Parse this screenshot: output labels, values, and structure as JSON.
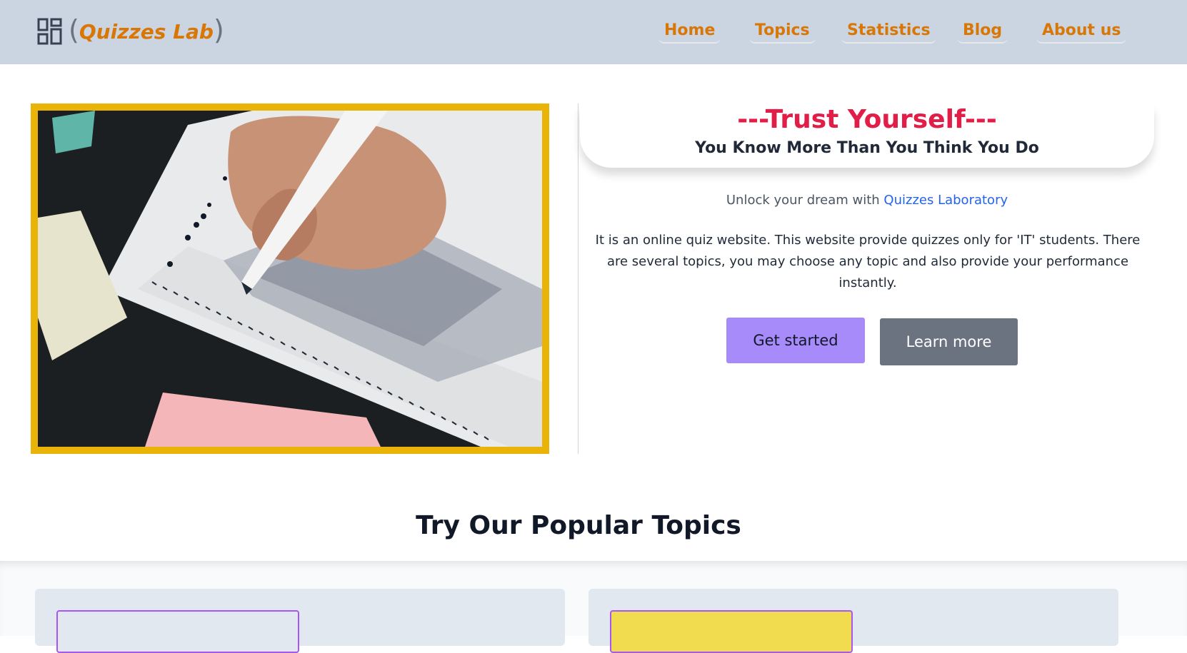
{
  "brand": {
    "name": "Quizzes Lab",
    "bracket_open": "(",
    "bracket_close": ")",
    "icon": "dashboard-grid-icon"
  },
  "nav": {
    "items": [
      {
        "label": "Home"
      },
      {
        "label": "Topics"
      },
      {
        "label": "Statistics"
      },
      {
        "label": "Blog"
      },
      {
        "label": "About us"
      }
    ]
  },
  "hero": {
    "image_alt": "hand filling answer sheet with pencil",
    "tagline_title": "---Trust Yourself---",
    "tagline_sub": "You Know More Than You Think You Do",
    "unlock_prefix": "Unlock your dream with",
    "unlock_highlight": "Quizzes Laboratory",
    "description": "It is an online quiz website. This website provide quizzes only for 'IT' students. There are several topics, you may choose any topic and also provide your performance instantly.",
    "primary_button": "Get started",
    "secondary_button": "Learn more"
  },
  "popular": {
    "title": "Try Our Popular Topics"
  },
  "colors": {
    "navbar_bg": "#cbd5e1",
    "accent_orange": "#d97706",
    "tagline_red": "#e11d48",
    "frame_yellow": "#eab308",
    "primary_btn": "#a78bfa",
    "secondary_btn": "#6b7280",
    "link_blue": "#2563eb"
  }
}
